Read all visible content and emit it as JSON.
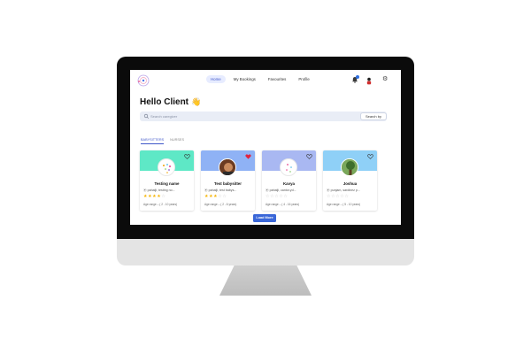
{
  "colors": {
    "accent": "#3f56c9",
    "load_more_bg": "#3a67d8",
    "star_on": "#f5b301",
    "star_off": "#c7c7c7"
  },
  "nav": {
    "items": [
      {
        "label": "Home",
        "active": true
      },
      {
        "label": "My Bookings",
        "active": false
      },
      {
        "label": "Favourites",
        "active": false
      },
      {
        "label": "Profile",
        "active": false
      }
    ],
    "icons": [
      "logo-icon",
      "bell-icon",
      "avatar",
      "gear-icon"
    ]
  },
  "greeting": {
    "text": "Hello Client",
    "emoji": "👋"
  },
  "search": {
    "placeholder": "Search caregiver",
    "button_label": "Search by"
  },
  "tabs": [
    {
      "label": "BABYSITTERS",
      "active": true
    },
    {
      "label": "NURSES",
      "active": false
    }
  ],
  "cards": [
    {
      "name": "Testing name",
      "location": "pahalji, testing no...",
      "rating": 4,
      "age_range": "Age range – ( 2 - 10 years)",
      "favourite": false,
      "banner_color": "#5ee8c6"
    },
    {
      "name": "Test babysitter",
      "location": "pahalji, test babys...",
      "rating": 3,
      "age_range": "Age range – ( 2 - 6 years)",
      "favourite": true,
      "banner_color": "#8fb2f5"
    },
    {
      "name": "Kavya",
      "location": "pahalji, cantor.yd...",
      "rating": 0,
      "age_range": "Age range – ( 4 - 16 years)",
      "favourite": false,
      "banner_color": "#a9b8f2"
    },
    {
      "name": "Joshua",
      "location": "punjam, sardinez p...",
      "rating": 0,
      "age_range": "Age range – ( 5 - 10 years)",
      "favourite": false,
      "banner_color": "#8fd0f7"
    }
  ],
  "load_more": {
    "label": "Load More"
  }
}
